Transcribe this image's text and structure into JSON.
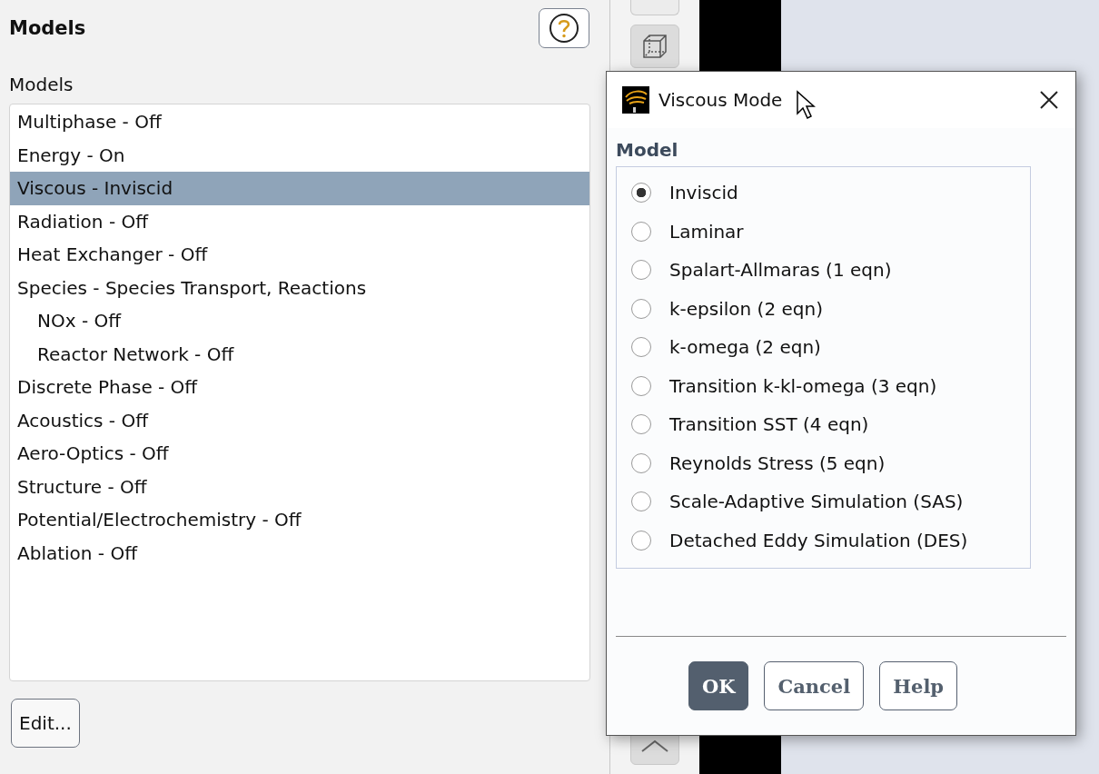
{
  "models_panel": {
    "title": "Models",
    "list_label": "Models",
    "items": [
      {
        "label": "Multiphase - Off",
        "selected": false
      },
      {
        "label": "Energy - On",
        "selected": false
      },
      {
        "label": "Viscous - Inviscid",
        "selected": true
      },
      {
        "label": "Radiation - Off",
        "selected": false
      },
      {
        "label": "Heat Exchanger - Off",
        "selected": false
      },
      {
        "label": "Species - Species Transport, Reactions",
        "selected": false,
        "children": [
          {
            "label": "NOx - Off",
            "selected": false
          },
          {
            "label": "Reactor Network - Off",
            "selected": false
          }
        ]
      },
      {
        "label": "Discrete Phase - Off",
        "selected": false
      },
      {
        "label": "Acoustics - Off",
        "selected": false
      },
      {
        "label": "Aero-Optics - Off",
        "selected": false
      },
      {
        "label": "Structure - Off",
        "selected": false
      },
      {
        "label": "Potential/Electrochemistry - Off",
        "selected": false
      },
      {
        "label": "Ablation - Off",
        "selected": false
      }
    ],
    "edit_button": "Edit..."
  },
  "dialog": {
    "title": "Viscous Mode",
    "group_label": "Model",
    "options": [
      {
        "label": "Inviscid",
        "selected": true
      },
      {
        "label": "Laminar",
        "selected": false
      },
      {
        "label": "Spalart-Allmaras (1 eqn)",
        "selected": false
      },
      {
        "label": "k-epsilon (2 eqn)",
        "selected": false
      },
      {
        "label": "k-omega (2 eqn)",
        "selected": false
      },
      {
        "label": "Transition k-kl-omega (3 eqn)",
        "selected": false
      },
      {
        "label": "Transition SST (4 eqn)",
        "selected": false
      },
      {
        "label": "Reynolds Stress (5 eqn)",
        "selected": false
      },
      {
        "label": "Scale-Adaptive Simulation (SAS)",
        "selected": false
      },
      {
        "label": "Detached Eddy Simulation (DES)",
        "selected": false
      }
    ],
    "buttons": [
      {
        "label": "OK",
        "kind": "primary"
      },
      {
        "label": "Cancel",
        "kind": "normal"
      },
      {
        "label": "Help",
        "kind": "normal"
      }
    ]
  }
}
